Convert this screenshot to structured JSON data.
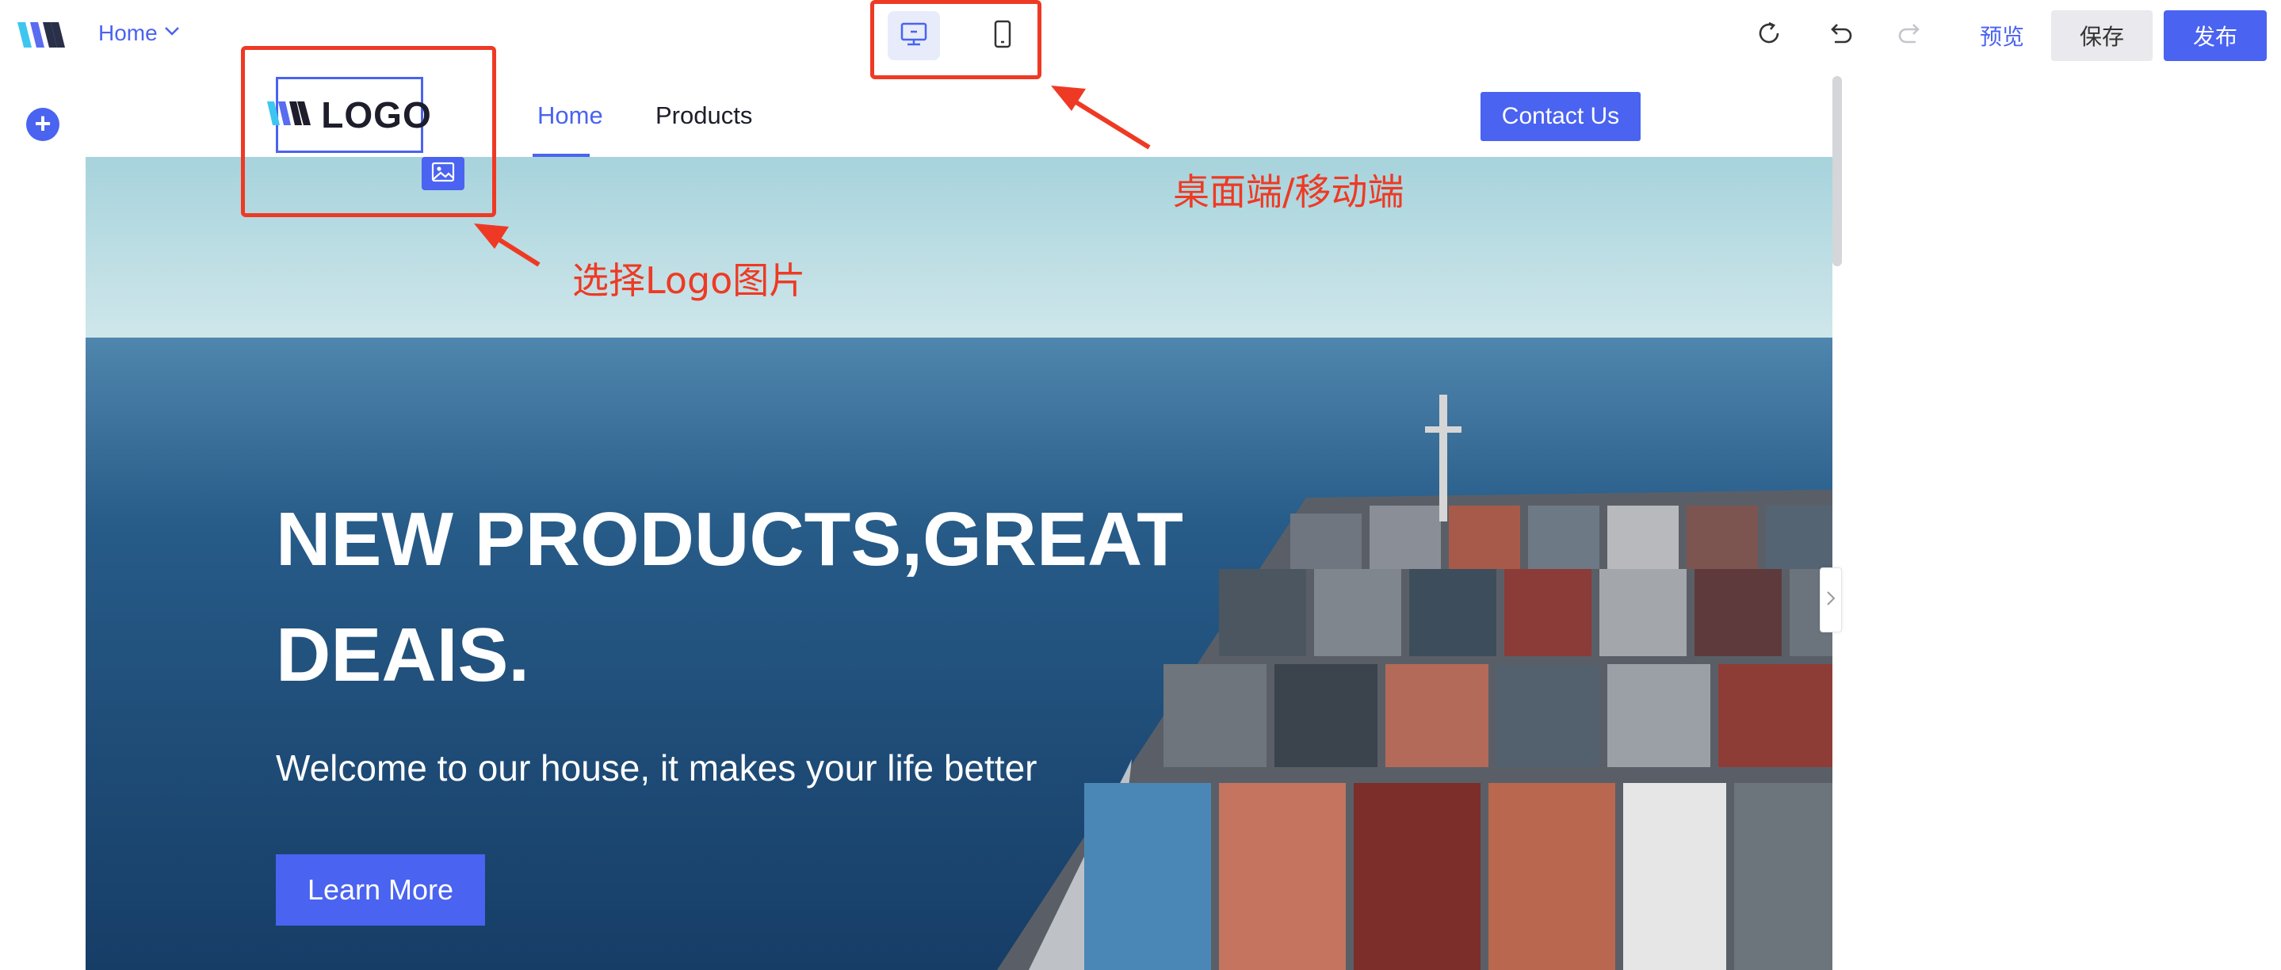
{
  "topbar": {
    "page_selector": "Home",
    "preview_label": "预览",
    "save_label": "保存",
    "publish_label": "发布"
  },
  "site": {
    "logo_text": "LOGO",
    "nav": [
      "Home",
      "Products"
    ],
    "active_nav": "Home",
    "contact_label": "Contact Us"
  },
  "hero": {
    "title": "NEW PRODUCTS,GREAT DEAIS.",
    "subtitle": "Welcome to our house, it makes your life better",
    "button": "Learn More"
  },
  "annotations": {
    "device_switch": "桌面端/移动端",
    "logo_select": "选择Logo图片"
  },
  "colors": {
    "accent": "#4a63f0",
    "annotation": "#ee3a24",
    "save_bg": "#e9e9ee"
  },
  "icons": [
    "brand-logo-icon",
    "chevron-down-icon",
    "desktop-icon",
    "mobile-icon",
    "reset-icon",
    "undo-icon",
    "redo-icon",
    "add-icon",
    "image-icon",
    "chevron-right-icon"
  ]
}
